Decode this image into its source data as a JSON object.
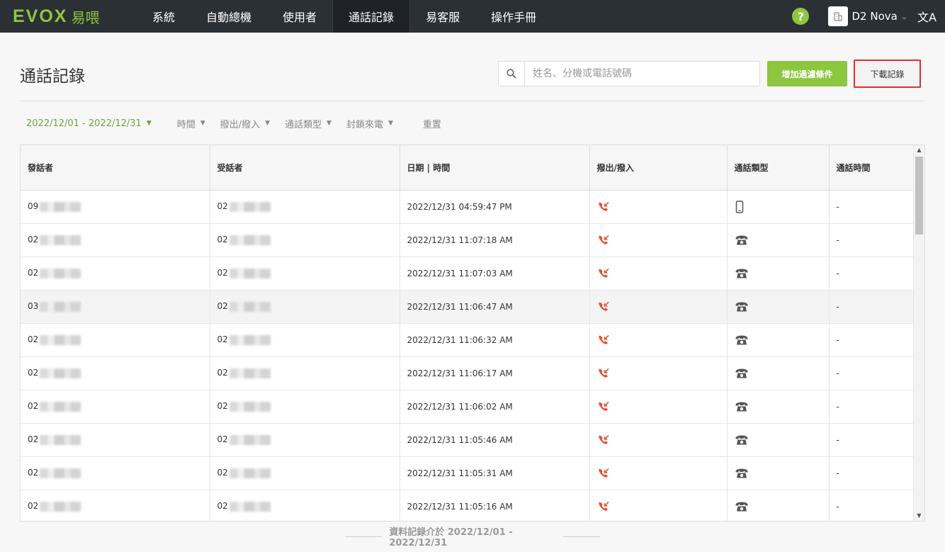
{
  "nav": {
    "logo_en": "EVOX",
    "logo_zh": "易喂",
    "items": [
      "系統",
      "自動總機",
      "使用者",
      "通話記錄",
      "易客服",
      "操作手冊"
    ],
    "active_index": 3,
    "help_label": "?",
    "company": "D2 Nova",
    "lang_label": "文A"
  },
  "page": {
    "title": "通話記錄",
    "search_placeholder": "姓名、分機或電話號碼",
    "search_value": "",
    "filter_button": "增加過濾條件",
    "download_button": "下載記錄"
  },
  "filters": {
    "date_range": "2022/12/01 - 2022/12/31",
    "time": "時間",
    "direction": "撥出/撥入",
    "call_type": "通話類型",
    "blocked": "封鎖來電",
    "reset": "重置"
  },
  "table": {
    "columns": [
      "發話者",
      "受話者",
      "日期 | 時間",
      "撥出/撥入",
      "通話類型",
      "通話時間"
    ],
    "rows": [
      {
        "caller": "09",
        "callee": "02",
        "datetime": "2022/12/31 04:59:47 PM",
        "direction": "incoming",
        "type": "mobile",
        "duration": "-"
      },
      {
        "caller": "02",
        "callee": "02",
        "datetime": "2022/12/31 11:07:18 AM",
        "direction": "incoming",
        "type": "landline",
        "duration": "-"
      },
      {
        "caller": "02",
        "callee": "02",
        "datetime": "2022/12/31 11:07:03 AM",
        "direction": "incoming",
        "type": "landline",
        "duration": "-"
      },
      {
        "caller": "03",
        "callee": "02",
        "datetime": "2022/12/31 11:06:47 AM",
        "direction": "incoming",
        "type": "landline",
        "duration": "-"
      },
      {
        "caller": "02",
        "callee": "02",
        "datetime": "2022/12/31 11:06:32 AM",
        "direction": "incoming",
        "type": "landline",
        "duration": "-"
      },
      {
        "caller": "02",
        "callee": "02",
        "datetime": "2022/12/31 11:06:17 AM",
        "direction": "incoming",
        "type": "landline",
        "duration": "-"
      },
      {
        "caller": "02",
        "callee": "02",
        "datetime": "2022/12/31 11:06:02 AM",
        "direction": "incoming",
        "type": "landline",
        "duration": "-"
      },
      {
        "caller": "02",
        "callee": "02",
        "datetime": "2022/12/31 11:05:46 AM",
        "direction": "incoming",
        "type": "landline",
        "duration": "-"
      },
      {
        "caller": "02",
        "callee": "02",
        "datetime": "2022/12/31 11:05:31 AM",
        "direction": "incoming",
        "type": "landline",
        "duration": "-"
      },
      {
        "caller": "02",
        "callee": "02",
        "datetime": "2022/12/31 11:05:16 AM",
        "direction": "incoming",
        "type": "landline",
        "duration": "-"
      }
    ],
    "highlighted_row": 3
  },
  "footer": {
    "note": "資料記錄介於 2022/12/01 - 2022/12/31"
  },
  "colors": {
    "brand_green": "#8dc63f",
    "navbar_bg": "#2b3035",
    "incoming_icon": "#e8502f",
    "download_border": "#e03030"
  }
}
